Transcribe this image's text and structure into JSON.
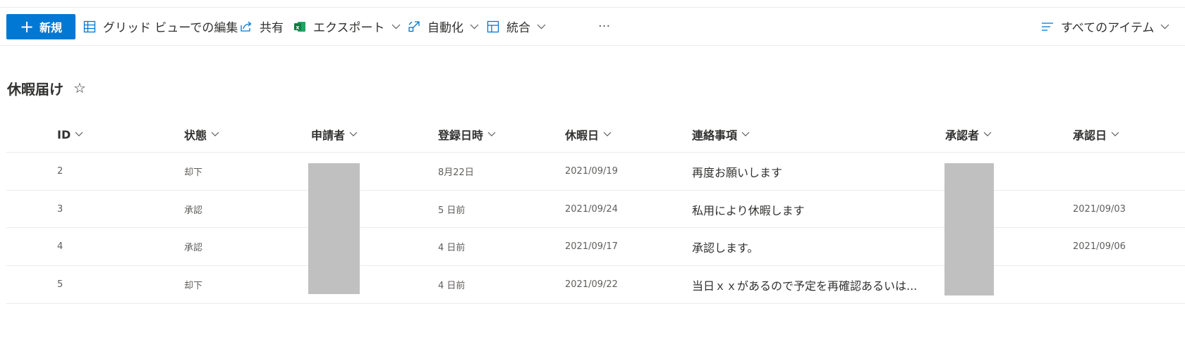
{
  "toolbar": {
    "new_label": "新規",
    "grid_edit_label": "グリッド ビューでの編集",
    "share_label": "共有",
    "export_label": "エクスポート",
    "automate_label": "自動化",
    "integrate_label": "統合",
    "more_label": "···",
    "view_label": "すべてのアイテム"
  },
  "list": {
    "title": "休暇届け",
    "columns": [
      "ID",
      "状態",
      "申請者",
      "登録日時",
      "休暇日",
      "連絡事項",
      "承認者",
      "承認日"
    ],
    "rows": [
      {
        "id": "2",
        "status": "却下",
        "registered": "8月22日",
        "leave_date": "2021/09/19",
        "note": "再度お願いします",
        "approved_date": ""
      },
      {
        "id": "3",
        "status": "承認",
        "registered": "5 日前",
        "leave_date": "2021/09/24",
        "note": "私用により休暇します",
        "approved_date": "2021/09/03"
      },
      {
        "id": "4",
        "status": "承認",
        "registered": "4 日前",
        "leave_date": "2021/09/17",
        "note": "承認します。",
        "approved_date": "2021/09/06"
      },
      {
        "id": "5",
        "status": "却下",
        "registered": "4 日前",
        "leave_date": "2021/09/22",
        "note": "当日ｘｘがあるので予定を再確認あるいは...",
        "approved_date": ""
      }
    ]
  },
  "colors": {
    "accent": "#0078d4",
    "excel_green": "#107c41",
    "redaction": "#c0c0c0"
  },
  "icons": [
    "plus-icon",
    "grid-icon",
    "share-icon",
    "excel-icon",
    "automate-icon",
    "integrate-icon",
    "more-icon",
    "view-lines-icon",
    "chevron-down-icon",
    "star-icon"
  ]
}
